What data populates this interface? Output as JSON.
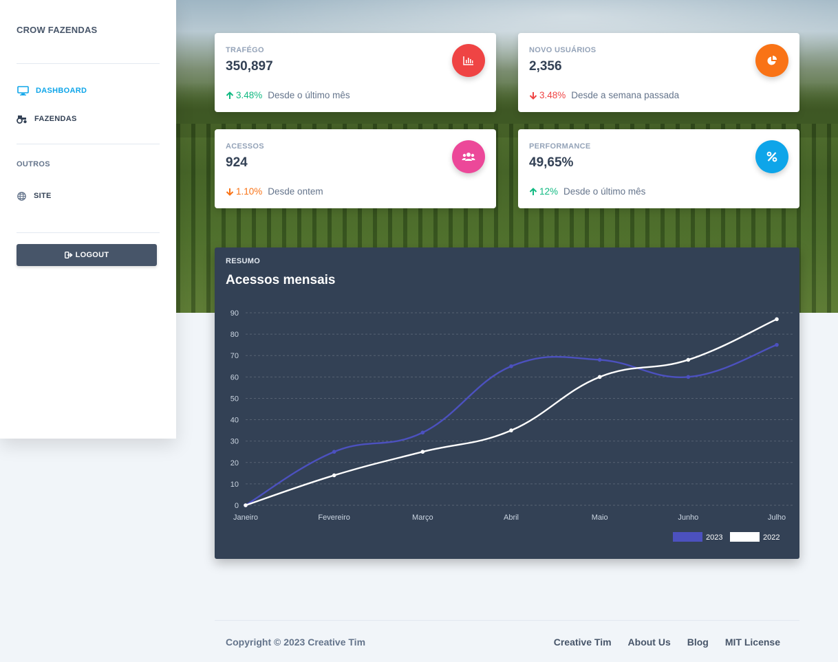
{
  "sidebar": {
    "brand": "CROW FAZENDAS",
    "nav": [
      {
        "label": "DASHBOARD",
        "icon": "monitor-icon",
        "active": true
      },
      {
        "label": "FAZENDAS",
        "icon": "tractor-icon",
        "active": false
      }
    ],
    "section_title": "OUTROS",
    "other": [
      {
        "label": "SITE",
        "icon": "globe-icon"
      }
    ],
    "logout_label": "LOGOUT"
  },
  "cards": [
    {
      "label": "TRAFÉGO",
      "value": "350,897",
      "change": "3.48%",
      "direction": "up",
      "since": "Desde o último mês",
      "icon": "bar-chart-icon",
      "icon_color": "#ef4444",
      "change_color": "#10b981"
    },
    {
      "label": "NOVO USUÁRIOS",
      "value": "2,356",
      "change": "3.48%",
      "direction": "down",
      "since": "Desde a semana passada",
      "icon": "pie-chart-icon",
      "icon_color": "#f97316",
      "change_color": "#ef4444"
    },
    {
      "label": "ACESSOS",
      "value": "924",
      "change": "1.10%",
      "direction": "down",
      "since": "Desde ontem",
      "icon": "users-icon",
      "icon_color": "#ec4899",
      "change_color": "#f97316"
    },
    {
      "label": "PERFORMANCE",
      "value": "49,65%",
      "change": "12%",
      "direction": "up",
      "since": "Desde o último mês",
      "icon": "percent-icon",
      "icon_color": "#0ea5e9",
      "change_color": "#10b981"
    }
  ],
  "chart_panel": {
    "kicker": "RESUMO",
    "title": "Acessos mensais"
  },
  "chart_data": {
    "type": "line",
    "categories": [
      "Janeiro",
      "Fevereiro",
      "Março",
      "Abril",
      "Maio",
      "Junho",
      "Julho"
    ],
    "series": [
      {
        "name": "2023",
        "values": [
          0,
          25,
          34,
          65,
          68,
          60,
          75
        ],
        "color": "#4c51bf"
      },
      {
        "name": "2022",
        "values": [
          0,
          14,
          25,
          35,
          60,
          68,
          87
        ],
        "color": "#ffffff"
      }
    ],
    "ylim": [
      0,
      90
    ],
    "yticks": [
      0,
      10,
      20,
      30,
      40,
      50,
      60,
      70,
      80,
      90
    ],
    "grid": true,
    "legend": "bottom-right"
  },
  "footer": {
    "copyright": "Copyright © 2023 Creative Tim",
    "links": [
      "Creative Tim",
      "About Us",
      "Blog",
      "MIT License"
    ]
  }
}
